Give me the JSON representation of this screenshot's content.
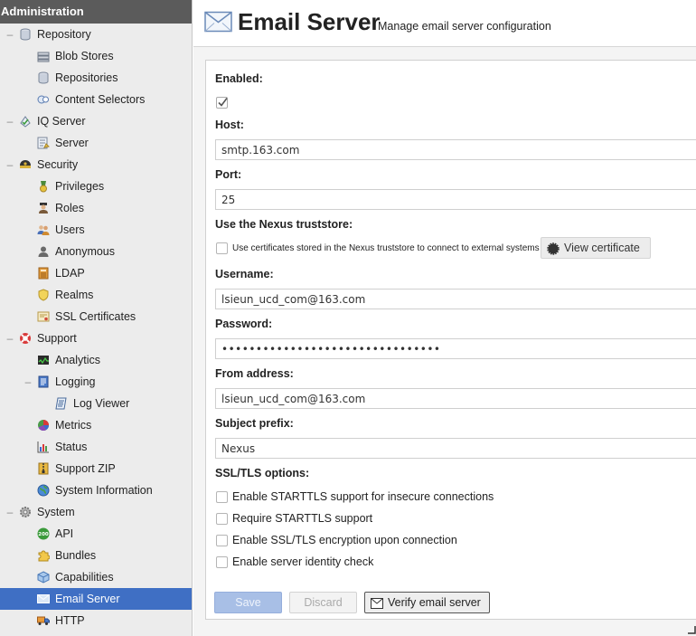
{
  "sidebar": {
    "header": "Administration",
    "items": [
      {
        "label": "Repository",
        "icon": "database-icon",
        "toggle": "–"
      },
      {
        "label": "Blob Stores",
        "icon": "storage-icon"
      },
      {
        "label": "Repositories",
        "icon": "database-icon"
      },
      {
        "label": "Content Selectors",
        "icon": "selector-icon"
      },
      {
        "label": "IQ Server",
        "icon": "iq-server-icon",
        "toggle": "–"
      },
      {
        "label": "Server",
        "icon": "server-settings-icon"
      },
      {
        "label": "Security",
        "icon": "security-icon",
        "toggle": "–"
      },
      {
        "label": "Privileges",
        "icon": "medal-icon"
      },
      {
        "label": "Roles",
        "icon": "roles-icon"
      },
      {
        "label": "Users",
        "icon": "users-icon"
      },
      {
        "label": "Anonymous",
        "icon": "anonymous-user-icon"
      },
      {
        "label": "LDAP",
        "icon": "ldap-book-icon"
      },
      {
        "label": "Realms",
        "icon": "shield-icon"
      },
      {
        "label": "SSL Certificates",
        "icon": "certificate-icon"
      },
      {
        "label": "Support",
        "icon": "support-lifebuoy-icon",
        "toggle": "–"
      },
      {
        "label": "Analytics",
        "icon": "analytics-icon"
      },
      {
        "label": "Logging",
        "icon": "logging-icon",
        "toggle": "–"
      },
      {
        "label": "Log Viewer",
        "icon": "log-scroll-icon"
      },
      {
        "label": "Metrics",
        "icon": "pie-chart-icon"
      },
      {
        "label": "Status",
        "icon": "status-bar-chart-icon"
      },
      {
        "label": "Support ZIP",
        "icon": "zip-archive-icon"
      },
      {
        "label": "System Information",
        "icon": "globe-icon"
      },
      {
        "label": "System",
        "icon": "gear-icon",
        "toggle": "–"
      },
      {
        "label": "API",
        "icon": "api-icon",
        "icon_text": "200"
      },
      {
        "label": "Bundles",
        "icon": "puzzle-icon"
      },
      {
        "label": "Capabilities",
        "icon": "cube-icon"
      },
      {
        "label": "Email Server",
        "icon": "envelope-icon",
        "selected": true
      },
      {
        "label": "HTTP",
        "icon": "truck-icon"
      }
    ]
  },
  "header": {
    "title": "Email Server",
    "subtitle": "Manage email server configuration",
    "icon": "envelope-icon"
  },
  "form": {
    "enabled_label": "Enabled:",
    "enabled_checked": true,
    "host_label": "Host:",
    "host_value": "smtp.163.com",
    "port_label": "Port:",
    "port_value": "25",
    "truststore_label": "Use the Nexus truststore:",
    "truststore_text": "Use certificates stored in the Nexus truststore to connect to external systems",
    "truststore_checked": false,
    "view_cert_label": "View certificate",
    "username_label": "Username:",
    "username_value": "lsieun_ucd_com@163.com",
    "password_label": "Password:",
    "password_value": "••••••••••••••••••••••••••••••••",
    "from_label": "From address:",
    "from_value": "lsieun_ucd_com@163.com",
    "prefix_label": "Subject prefix:",
    "prefix_value": "Nexus",
    "ssl_label": "SSL/TLS options:",
    "ssl_options": [
      {
        "label": "Enable STARTTLS support for insecure connections",
        "checked": false
      },
      {
        "label": "Require STARTTLS support",
        "checked": false
      },
      {
        "label": "Enable SSL/TLS encryption upon connection",
        "checked": false
      },
      {
        "label": "Enable server identity check",
        "checked": false
      }
    ]
  },
  "buttons": {
    "save": "Save",
    "discard": "Discard",
    "verify": "Verify email server"
  },
  "colors": {
    "sidebar_header_bg": "#5b5b5b",
    "selected_bg": "#3f6fc4",
    "save_bg": "#a8bfe6"
  }
}
